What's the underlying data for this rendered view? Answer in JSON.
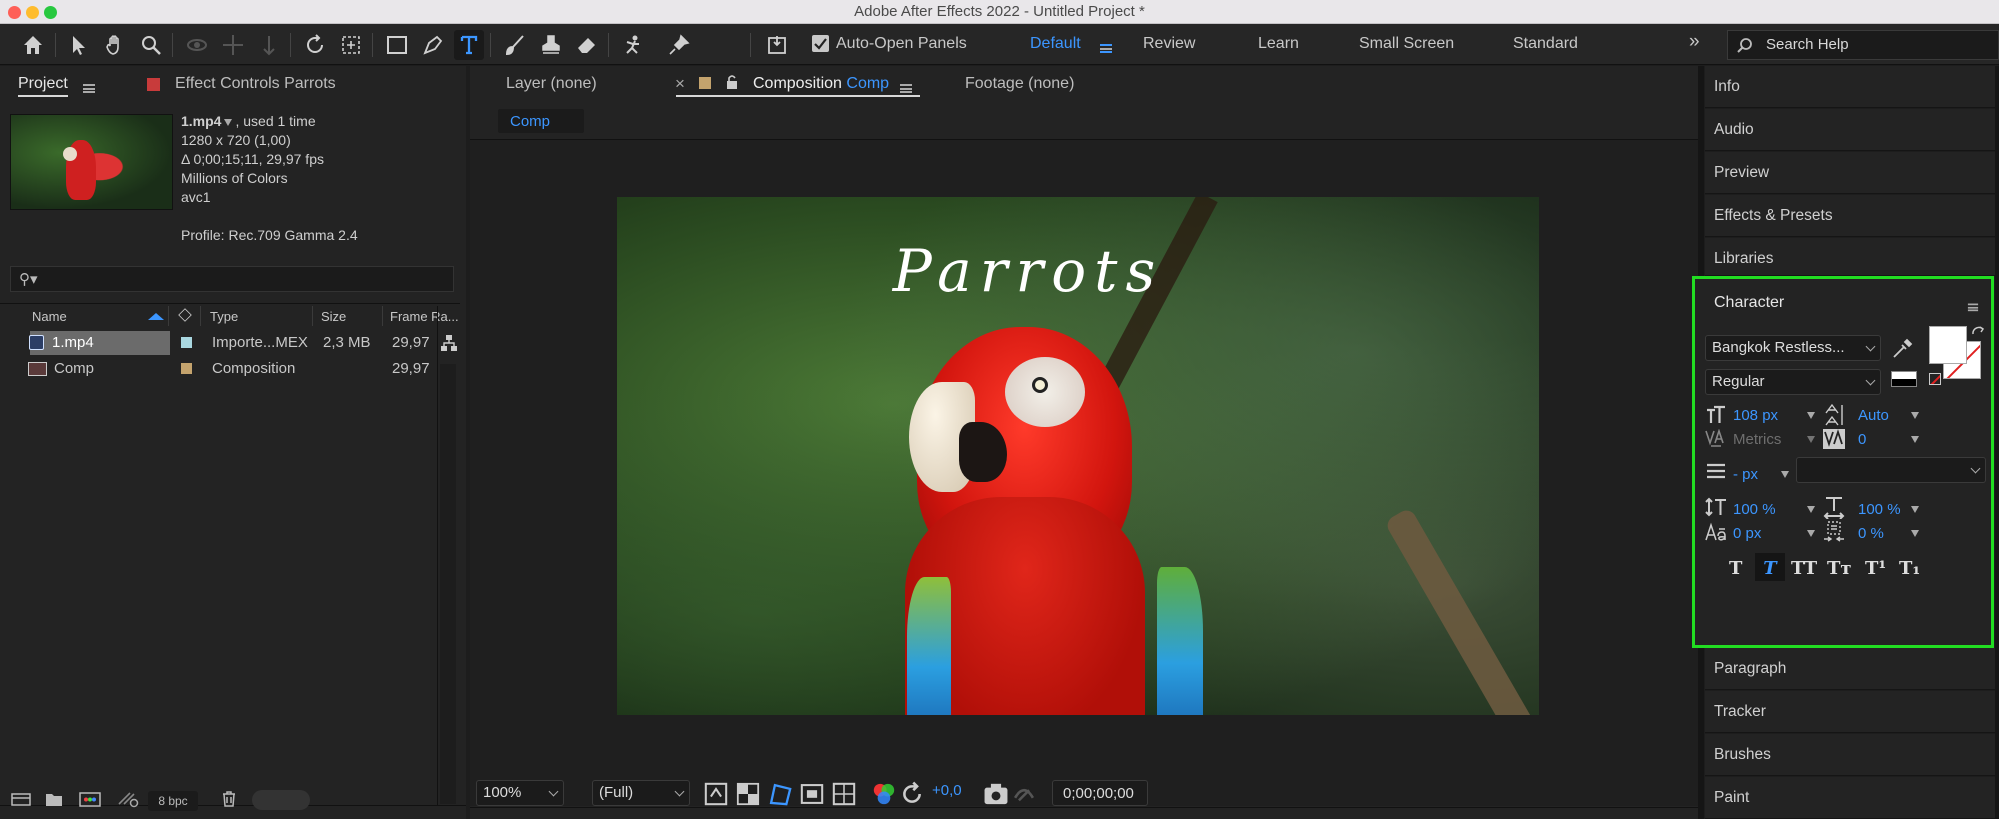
{
  "window": {
    "title": "Adobe After Effects 2022 - Untitled Project *"
  },
  "toolbar": {
    "tools": [
      "home-icon",
      "selection-icon",
      "hand-icon",
      "zoom-icon",
      "orbit-icon",
      "pan-icon",
      "dolly-icon",
      "rotate-icon",
      "pan-behind-icon",
      "rectangle-icon",
      "pen-icon",
      "type-icon",
      "brush-icon",
      "clone-stamp-icon",
      "eraser-icon",
      "roto-brush-icon",
      "puppet-pin-icon"
    ],
    "auto_open_label": "Auto-Open Panels",
    "workspaces": [
      "Default",
      "Review",
      "Learn",
      "Small Screen",
      "Standard"
    ],
    "active_workspace": "Default",
    "more": "»",
    "search_placeholder": "Search Help"
  },
  "project": {
    "tab_label": "Project",
    "effect_controls_label": "Effect Controls Parrots",
    "file": {
      "name": "1.mp4",
      "used": ", used 1 time",
      "resolution": "1280 x 720 (1,00)",
      "duration": "Δ 0;00;15;11, 29,97 fps",
      "colors": "Millions of Colors",
      "codec": "avc1",
      "profile": "Profile: Rec.709 Gamma 2.4"
    },
    "search_glyph": "⚲▾",
    "columns": [
      "Name",
      "Type",
      "Size",
      "Frame Ra..."
    ],
    "rows": [
      {
        "name": "1.mp4",
        "type": "Importe...MEX",
        "size": "2,3 MB",
        "fps": "29,97",
        "tag_color": "#a9d7e0"
      },
      {
        "name": "Comp",
        "type": "Composition",
        "size": "",
        "fps": "29,97",
        "tag_color": "#c4a36d"
      }
    ],
    "bpc": "8 bpc"
  },
  "viewer": {
    "layer_tab": "Layer (none)",
    "comp_tab_prefix": "Composition",
    "comp_tab_name": "Comp",
    "footage_tab": "Footage (none)",
    "close_glyph": "×",
    "comp_chip": "Comp",
    "overlay_text": "Parrots",
    "zoom": "100%",
    "resolution": "(Full)",
    "exposure": "+0,0",
    "timecode": "0;00;00;00"
  },
  "right_panels": {
    "top": [
      "Info",
      "Audio",
      "Preview",
      "Effects & Presets",
      "Libraries"
    ],
    "bottom": [
      "Paragraph",
      "Tracker",
      "Brushes",
      "Paint"
    ]
  },
  "character": {
    "title": "Character",
    "font": "Bangkok Restless...",
    "style": "Regular",
    "font_size": "108 px",
    "leading": "Auto",
    "kerning": "Metrics",
    "tracking": "0",
    "stroke": "- px",
    "vscale": "100 %",
    "hscale": "100 %",
    "baseline": "0 px",
    "tsume": "0 %",
    "style_buttons": [
      "T",
      "T",
      "TT",
      "Tт",
      "T¹",
      "T₁"
    ],
    "highlight_color": "#22dd22"
  }
}
